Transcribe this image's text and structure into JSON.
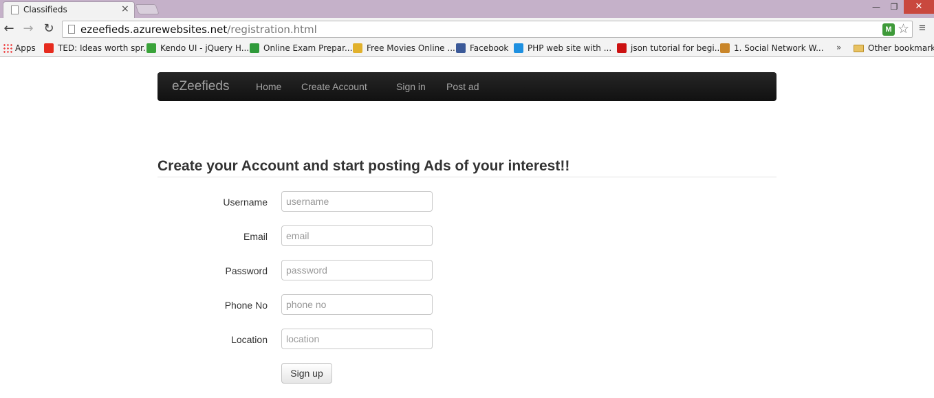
{
  "browser": {
    "tab_title": "Classifieds",
    "tab_close": "×",
    "url_host": "ezeefieds.azurewebsites.net",
    "url_path": "/registration.html",
    "back": "←",
    "forward": "→",
    "reload": "↻",
    "win_min": "—",
    "win_max": "❐",
    "win_close": "✕",
    "star": "☆",
    "menu": "≡",
    "ext": "M"
  },
  "bookmarks": {
    "apps": "Apps",
    "items": [
      {
        "label": "TED: Ideas worth spr...",
        "color": "#e62b1e"
      },
      {
        "label": "Kendo UI - jQuery H...",
        "color": "#3aa33a"
      },
      {
        "label": "Online Exam Prepar...",
        "color": "#2f9a3a"
      },
      {
        "label": "Free Movies Online ...",
        "color": "#e1b12c"
      },
      {
        "label": "Facebook",
        "color": "#3b5998"
      },
      {
        "label": "PHP web site with ...",
        "color": "#1e90e0"
      },
      {
        "label": "json tutorial for begi...",
        "color": "#cc1111"
      },
      {
        "label": "1. Social Network W...",
        "color": "#c9862a"
      }
    ],
    "more": "»",
    "other": "Other bookmarks"
  },
  "navbar": {
    "brand": "eZeefieds",
    "links": [
      "Home",
      "Create Account",
      "Sign in",
      "Post ad"
    ]
  },
  "form": {
    "heading": "Create your Account and start posting Ads of your interest!!",
    "fields": [
      {
        "label": "Username",
        "placeholder": "username"
      },
      {
        "label": "Email",
        "placeholder": "email"
      },
      {
        "label": "Password",
        "placeholder": "password"
      },
      {
        "label": "Phone No",
        "placeholder": "phone no"
      },
      {
        "label": "Location",
        "placeholder": "location"
      }
    ],
    "submit": "Sign up"
  }
}
